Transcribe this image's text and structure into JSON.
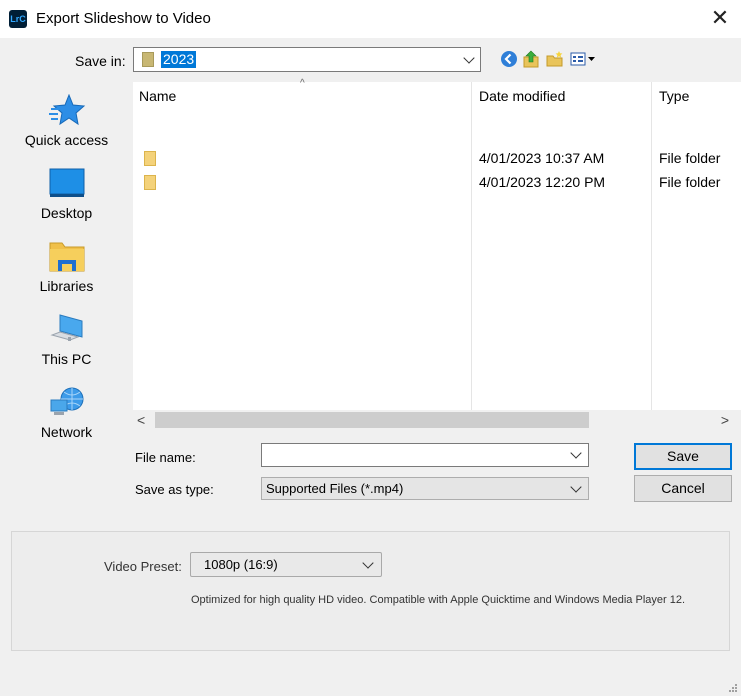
{
  "window": {
    "title": "Export Slideshow to Video",
    "app_icon_text": "LrC",
    "close_label": "✕"
  },
  "save_in": {
    "label": "Save in:",
    "value": "2023"
  },
  "toolbar": {
    "icons": [
      "back-icon",
      "up-folder-icon",
      "new-folder-icon",
      "view-menu-icon"
    ]
  },
  "places": [
    {
      "label": "Quick access",
      "icon": "star-icon"
    },
    {
      "label": "Desktop",
      "icon": "desktop-icon"
    },
    {
      "label": "Libraries",
      "icon": "libraries-icon"
    },
    {
      "label": "This PC",
      "icon": "computer-icon"
    },
    {
      "label": "Network",
      "icon": "network-icon"
    }
  ],
  "file_list": {
    "columns": [
      "Name",
      "Date modified",
      "Type"
    ],
    "rows": [
      {
        "name": "",
        "date": "4/01/2023 10:37 AM",
        "type": "File folder"
      },
      {
        "name": "",
        "date": "4/01/2023 12:20 PM",
        "type": "File folder"
      }
    ],
    "scroll_left": "<",
    "scroll_right": ">"
  },
  "file_name": {
    "label": "File name:",
    "value": ""
  },
  "save_as_type": {
    "label": "Save as type:",
    "value": "Supported Files (*.mp4)"
  },
  "buttons": {
    "save": "Save",
    "cancel": "Cancel"
  },
  "video_preset": {
    "label": "Video Preset:",
    "value": "1080p (16:9)",
    "description": "Optimized for high quality HD video. Compatible with Apple Quicktime and Windows Media Player 12."
  },
  "colors": {
    "accent": "#0078d7",
    "folder": "#f4d27a",
    "dialog_bg": "#f0f0f0"
  }
}
